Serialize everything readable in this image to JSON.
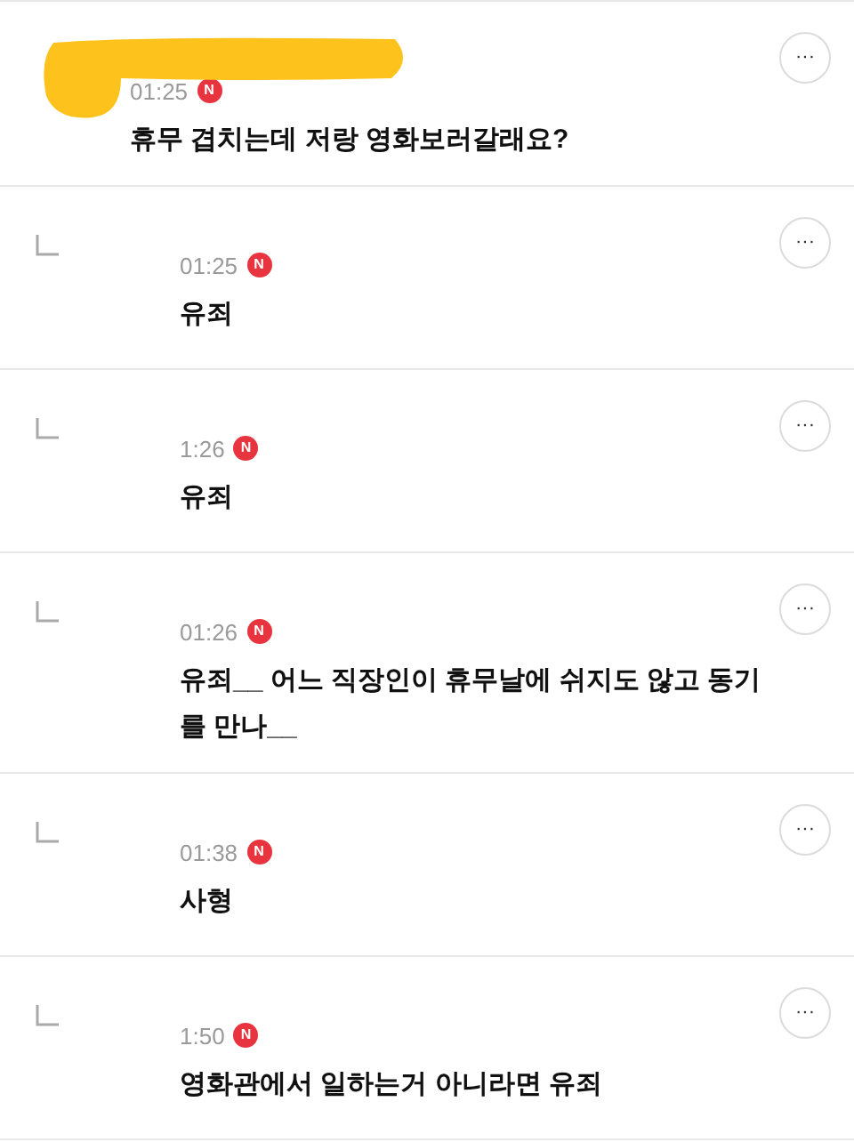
{
  "comment": {
    "time": "01:25",
    "badge": "N",
    "text": "휴무 겹치는데 저랑 영화보러갈래요?",
    "more": "···",
    "replies": [
      {
        "time": "01:25",
        "badge": "N",
        "text": "유죄",
        "more": "···"
      },
      {
        "time": "1:26",
        "badge": "N",
        "text": "유죄",
        "more": "···"
      },
      {
        "time": "01:26",
        "badge": "N",
        "text": "유죄__ 어느 직장인이 휴무날에 쉬지도 않고 동기를 만나__",
        "more": "···"
      },
      {
        "time": "01:38",
        "badge": "N",
        "text": "사형",
        "more": "···"
      },
      {
        "time": "1:50",
        "badge": "N",
        "text": "영화관에서 일하는거 아니라면 유죄",
        "more": "···"
      }
    ]
  }
}
